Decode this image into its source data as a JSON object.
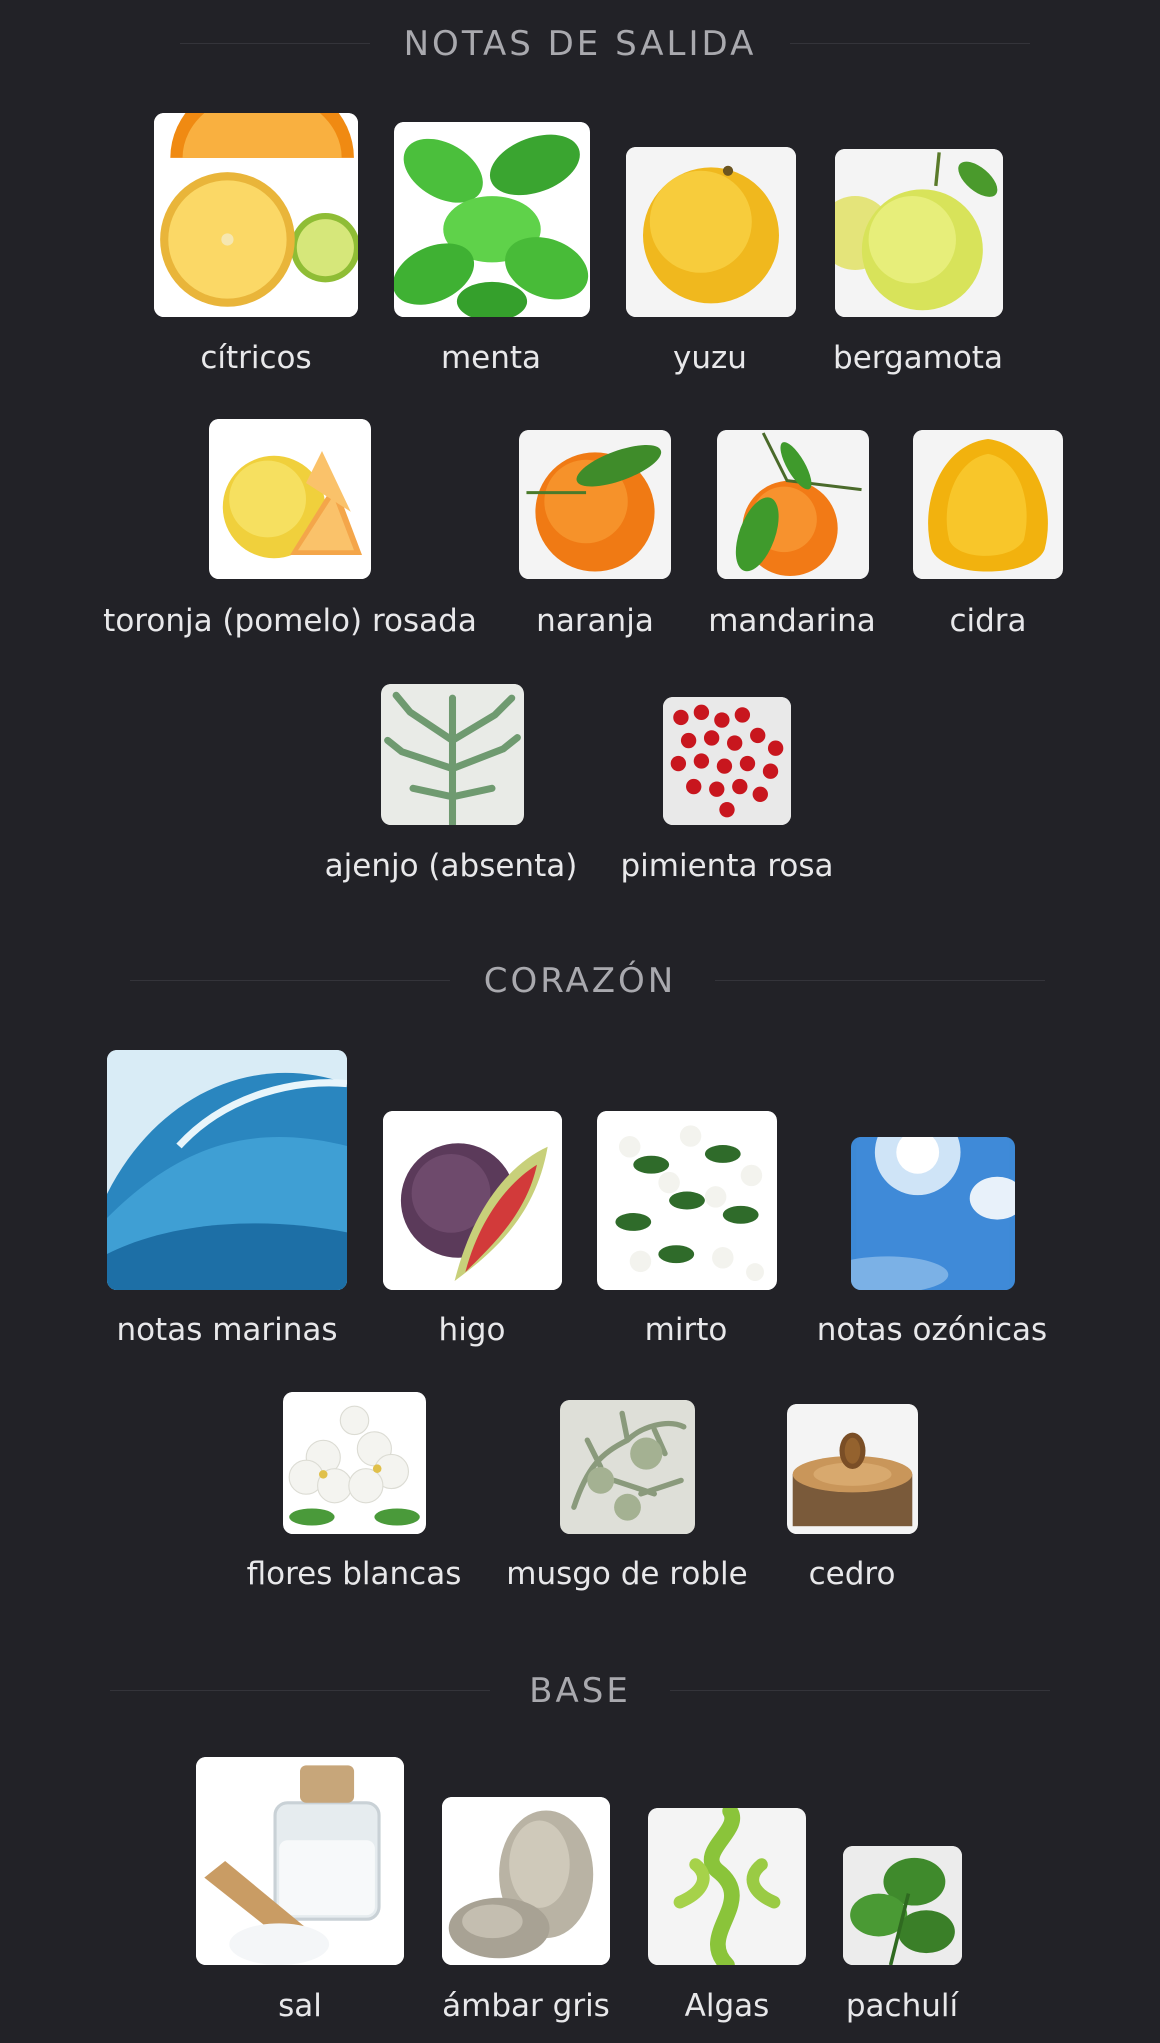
{
  "sections": [
    {
      "title": "NOTAS DE SALIDA",
      "items": [
        {
          "label": "cítricos",
          "icon": "citrus-image"
        },
        {
          "label": "menta",
          "icon": "mint-image"
        },
        {
          "label": "yuzu",
          "icon": "yuzu-image"
        },
        {
          "label": "bergamota",
          "icon": "bergamot-image"
        },
        {
          "label": "toronja (pomelo) rosada",
          "icon": "grapefruit-image"
        },
        {
          "label": "naranja",
          "icon": "orange-image"
        },
        {
          "label": "mandarina",
          "icon": "mandarin-image"
        },
        {
          "label": "cidra",
          "icon": "citron-image"
        },
        {
          "label": "ajenjo (absenta)",
          "icon": "wormwood-image"
        },
        {
          "label": "pimienta rosa",
          "icon": "pink-pepper-image"
        }
      ]
    },
    {
      "title": "CORAZÓN",
      "items": [
        {
          "label": "notas marinas",
          "icon": "wave-image"
        },
        {
          "label": "higo",
          "icon": "fig-image"
        },
        {
          "label": "mirto",
          "icon": "myrtle-image"
        },
        {
          "label": "notas ozónicas",
          "icon": "sky-image"
        },
        {
          "label": "flores blancas",
          "icon": "white-flowers-image"
        },
        {
          "label": "musgo de roble",
          "icon": "oakmoss-image"
        },
        {
          "label": "cedro",
          "icon": "cedar-image"
        }
      ]
    },
    {
      "title": "BASE",
      "items": [
        {
          "label": "sal",
          "icon": "salt-image"
        },
        {
          "label": "ámbar gris",
          "icon": "ambergris-image"
        },
        {
          "label": "Algas",
          "icon": "seaweed-image"
        },
        {
          "label": "pachulí",
          "icon": "patchouli-image"
        }
      ]
    }
  ]
}
